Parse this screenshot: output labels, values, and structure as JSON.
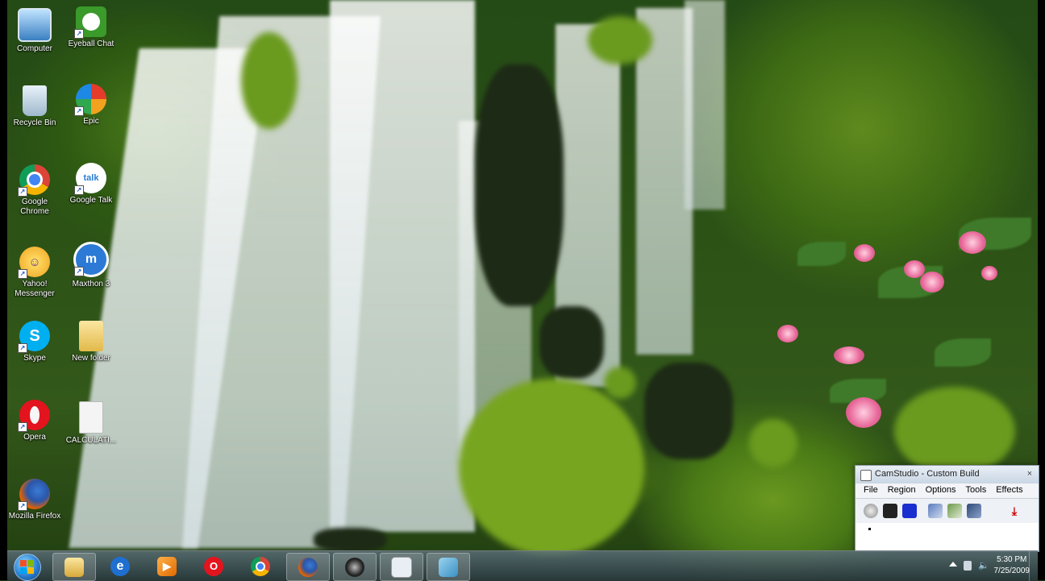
{
  "desktop": {
    "icons": [
      {
        "label": "Computer",
        "icon": "computer-icon"
      },
      {
        "label": "Eyeball Chat",
        "icon": "eyeball-chat-icon"
      },
      {
        "label": "Recycle Bin",
        "icon": "recycle-bin-icon"
      },
      {
        "label": "Epic",
        "icon": "epic-browser-icon"
      },
      {
        "label": "Google Chrome",
        "icon": "chrome-icon"
      },
      {
        "label": "Google Talk",
        "icon": "google-talk-icon"
      },
      {
        "label": "Yahoo! Messenger",
        "icon": "yahoo-messenger-icon"
      },
      {
        "label": "Maxthon 3",
        "icon": "maxthon-icon"
      },
      {
        "label": "Skype",
        "icon": "skype-icon"
      },
      {
        "label": "New folder",
        "icon": "folder-icon"
      },
      {
        "label": "Opera",
        "icon": "opera-icon"
      },
      {
        "label": "CALCULATI...",
        "icon": "document-icon"
      },
      {
        "label": "Mozilla Firefox",
        "icon": "firefox-icon"
      }
    ]
  },
  "taskbar": {
    "pinned": [
      {
        "name": "windows-explorer",
        "icon": "folder-icon"
      },
      {
        "name": "internet-explorer",
        "icon": "ie-icon"
      },
      {
        "name": "media-player",
        "icon": "media-player-icon"
      },
      {
        "name": "opera",
        "icon": "opera-icon"
      },
      {
        "name": "chrome",
        "icon": "chrome-icon"
      },
      {
        "name": "firefox",
        "icon": "firefox-icon"
      },
      {
        "name": "camstudio",
        "icon": "webcam-icon"
      },
      {
        "name": "window-active",
        "icon": "window-icon"
      },
      {
        "name": "aero",
        "icon": "aero-icon"
      }
    ],
    "clock": {
      "time": "5:30 PM",
      "date": "7/25/2009"
    }
  },
  "camstudio": {
    "title": "CamStudio - Custom Build",
    "menu": [
      "File",
      "Region",
      "Options",
      "Tools",
      "Effects"
    ],
    "close_glyph": "×",
    "tools": [
      "record-icon",
      "pause-icon",
      "stop-icon",
      "region-icon",
      "annotation-icon",
      "webcam-icon",
      "minimize-icon"
    ]
  },
  "colors": {
    "taskbar": "#3a4a52",
    "chrome_red": "#db4437",
    "opera_red": "#e3141e",
    "skype_blue": "#00aff0",
    "firefox_orange": "#e66000"
  }
}
